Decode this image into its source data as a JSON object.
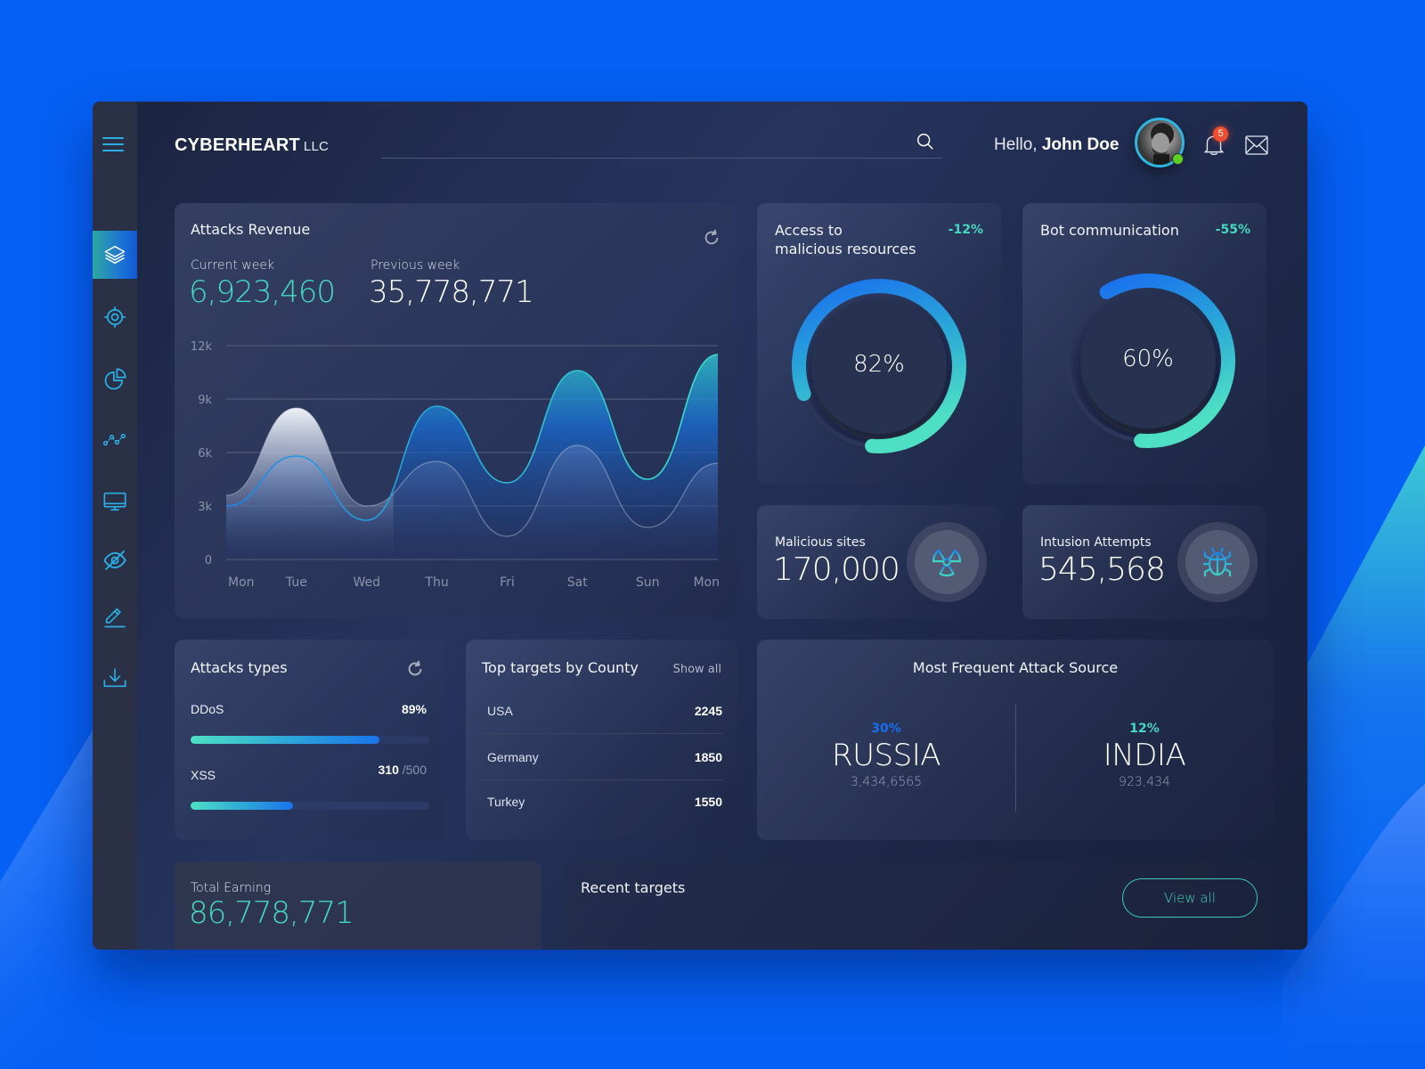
{
  "brand": {
    "name": "CYBERHEART",
    "suffix": "LLC"
  },
  "search": {
    "placeholder": "",
    "value": ""
  },
  "user": {
    "greeting": "Hello,",
    "name": "John Doe",
    "status": "online"
  },
  "notifications": {
    "count": "5"
  },
  "colors": {
    "accent_teal": "#45d9c0",
    "accent_blue": "#1a74ea",
    "page_bg": "#0560f5",
    "badge_red": "#ef4d2d",
    "online_green": "#5ed11f"
  },
  "sidebar": {
    "items": [
      {
        "name": "layers",
        "icon": "layers-icon",
        "active": true
      },
      {
        "name": "target",
        "icon": "target-icon",
        "active": false
      },
      {
        "name": "pie-chart",
        "icon": "pie-chart-icon",
        "active": false
      },
      {
        "name": "analytics",
        "icon": "line-chart-icon",
        "active": false
      },
      {
        "name": "monitor",
        "icon": "monitor-icon",
        "active": false
      },
      {
        "name": "hidden",
        "icon": "eye-off-icon",
        "active": false
      },
      {
        "name": "edit",
        "icon": "pencil-icon",
        "active": false
      },
      {
        "name": "download",
        "icon": "download-icon",
        "active": false
      }
    ]
  },
  "revenue": {
    "title": "Attacks Revenue",
    "current_label": "Current week",
    "current_value": "6,923,460",
    "previous_label": "Previous week",
    "previous_value": "35,778,771"
  },
  "chart_data": {
    "type": "area",
    "title": "Attacks Revenue",
    "xlabel": "",
    "ylabel": "",
    "categories": [
      "Mon",
      "Tue",
      "Wed",
      "Thu",
      "Fri",
      "Sat",
      "Sun",
      "Mon"
    ],
    "yticks": [
      "0",
      "3k",
      "6k",
      "9k",
      "12k"
    ],
    "ylim": [
      0,
      12000
    ],
    "grid": true,
    "series": [
      {
        "name": "Current week",
        "values": [
          3000,
          5800,
          2200,
          8600,
          4300,
          10600,
          4500,
          11500
        ],
        "color": "#2ab5e0"
      },
      {
        "name": "Previous week",
        "values": [
          3600,
          8500,
          3000,
          5500,
          1300,
          6400,
          1800,
          5400
        ],
        "color": "#ffffff"
      }
    ]
  },
  "gauges": [
    {
      "title_line1": "Access to",
      "title_line2": "malicious resources",
      "delta": "-12%",
      "value": "82%",
      "fraction": 0.82
    },
    {
      "title_line1": "Bot communication",
      "title_line2": "",
      "delta": "-55%",
      "value": "60%",
      "fraction": 0.6
    }
  ],
  "mini_stats": [
    {
      "label": "Malicious sites",
      "value": "170,000",
      "icon": "radiation-icon"
    },
    {
      "label": "Intusion Attempts",
      "value": "545,568",
      "icon": "bug-icon"
    }
  ],
  "attack_types": {
    "title": "Attacks types",
    "items": [
      {
        "label": "DDoS",
        "value": "89%",
        "total": "",
        "fraction": 0.79
      },
      {
        "label": "XSS",
        "value": "310",
        "total": "/500",
        "fraction": 0.43
      }
    ]
  },
  "top_targets": {
    "title": "Top targets by County",
    "show_all": "Show all",
    "rows": [
      {
        "country": "USA",
        "count": "2245"
      },
      {
        "country": "Germany",
        "count": "1850"
      },
      {
        "country": "Turkey",
        "count": "1550"
      }
    ]
  },
  "attack_source": {
    "title": "Most Frequent Attack Source",
    "items": [
      {
        "pct": "30%",
        "country": "RUSSIA",
        "count": "3,434,6565",
        "color": "#1a6cf0"
      },
      {
        "pct": "12%",
        "country": "INDIA",
        "count": "923,434",
        "color": "#45d9c0"
      }
    ]
  },
  "total_earning": {
    "label": "Total Earning",
    "value": "86,778,771"
  },
  "recent_targets": {
    "title": "Recent targets",
    "view_all": "View all"
  }
}
